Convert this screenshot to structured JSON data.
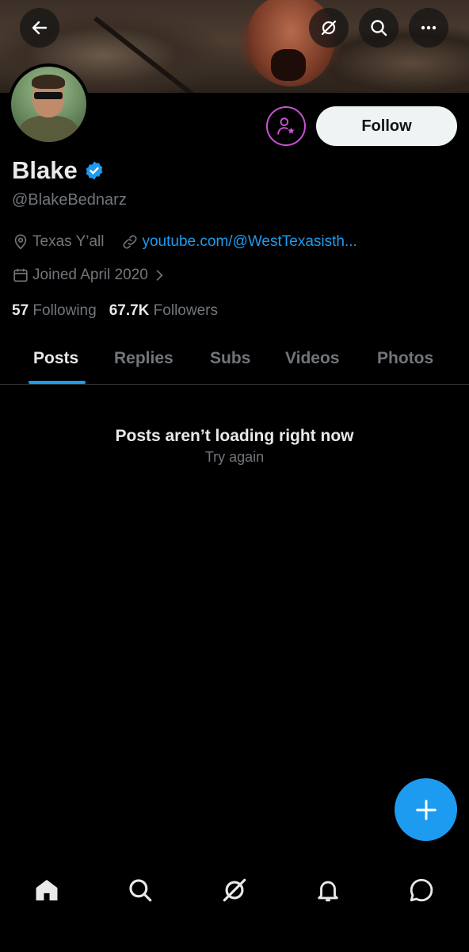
{
  "header": {
    "back_icon": "arrow-left-icon",
    "grok_icon": "grok-icon",
    "search_icon": "search-icon",
    "more_icon": "more-icon"
  },
  "profile": {
    "display_name": "Blake",
    "verified": true,
    "handle": "@BlakeBednarz",
    "location": "Texas Y’all",
    "link": "youtube.com/@WestTexasisth...",
    "joined": "Joined April 2020",
    "following_count": "57",
    "following_label": "Following",
    "followers_count": "67.7K",
    "followers_label": "Followers"
  },
  "actions": {
    "follow_label": "Follow",
    "subscribe_icon": "subscribe-person-star-icon"
  },
  "tabs": [
    {
      "label": "Posts",
      "active": true
    },
    {
      "label": "Replies",
      "active": false
    },
    {
      "label": "Subs",
      "active": false
    },
    {
      "label": "Videos",
      "active": false
    },
    {
      "label": "Photos",
      "active": false
    }
  ],
  "feed": {
    "error_message": "Posts aren’t loading right now",
    "retry_label": "Try again"
  },
  "bottom_nav": [
    "home-icon",
    "search-icon",
    "grok-icon",
    "notifications-icon",
    "messages-icon"
  ],
  "colors": {
    "accent": "#1d9bf0",
    "subscribe": "#c953d3",
    "background": "#000000",
    "muted": "#71767b"
  }
}
